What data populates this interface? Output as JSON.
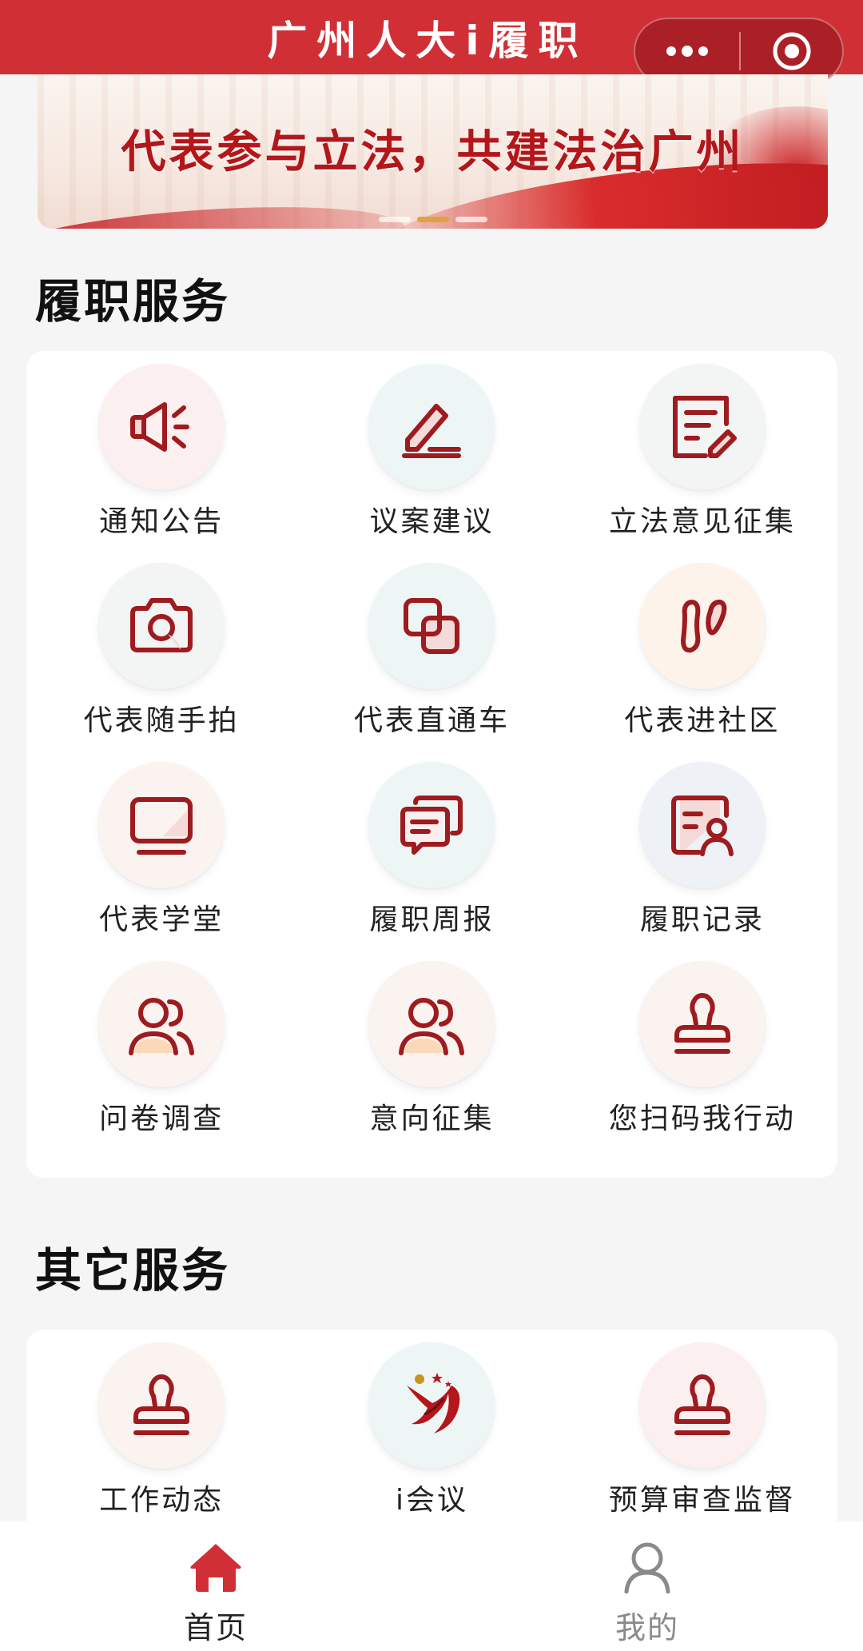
{
  "header": {
    "title": "广州人大i履职",
    "more_icon": "more-dots-icon",
    "close_icon": "target-close-icon",
    "background_color": "#d12f36"
  },
  "banner": {
    "slogan": "代表参与立法，共建法治广州",
    "slide_count": 3,
    "active_slide": 2
  },
  "sections": {
    "duty": {
      "title": "履职服务",
      "items": [
        {
          "label": "通知公告",
          "icon": "megaphone-icon"
        },
        {
          "label": "议案建议",
          "icon": "pen-edit-icon"
        },
        {
          "label": "立法意见征集",
          "icon": "document-edit-icon"
        },
        {
          "label": "代表随手拍",
          "icon": "camera-icon"
        },
        {
          "label": "代表直通车",
          "icon": "overlap-squares-icon"
        },
        {
          "label": "代表进社区",
          "icon": "footsteps-icon"
        },
        {
          "label": "代表学堂",
          "icon": "monitor-icon"
        },
        {
          "label": "履职周报",
          "icon": "chat-bubbles-icon"
        },
        {
          "label": "履职记录",
          "icon": "user-record-icon"
        },
        {
          "label": "问卷调查",
          "icon": "users-icon"
        },
        {
          "label": "意向征集",
          "icon": "users-icon"
        },
        {
          "label": "您扫码我行动",
          "icon": "stamp-icon"
        }
      ]
    },
    "other": {
      "title": "其它服务",
      "items": [
        {
          "label": "工作动态",
          "icon": "stamp-icon"
        },
        {
          "label": "i会议",
          "icon": "meeting-logo-icon"
        },
        {
          "label": "预算审查监督",
          "icon": "stamp-icon"
        }
      ]
    }
  },
  "tabbar": {
    "items": [
      {
        "label": "首页",
        "icon": "home-icon",
        "active": true
      },
      {
        "label": "我的",
        "icon": "person-icon",
        "active": false
      }
    ]
  },
  "colors": {
    "accent": "#b3161b",
    "icon_stroke": "#9e1b1f",
    "tab_active": "#d12f36",
    "tab_inactive": "#8a8a8a"
  }
}
